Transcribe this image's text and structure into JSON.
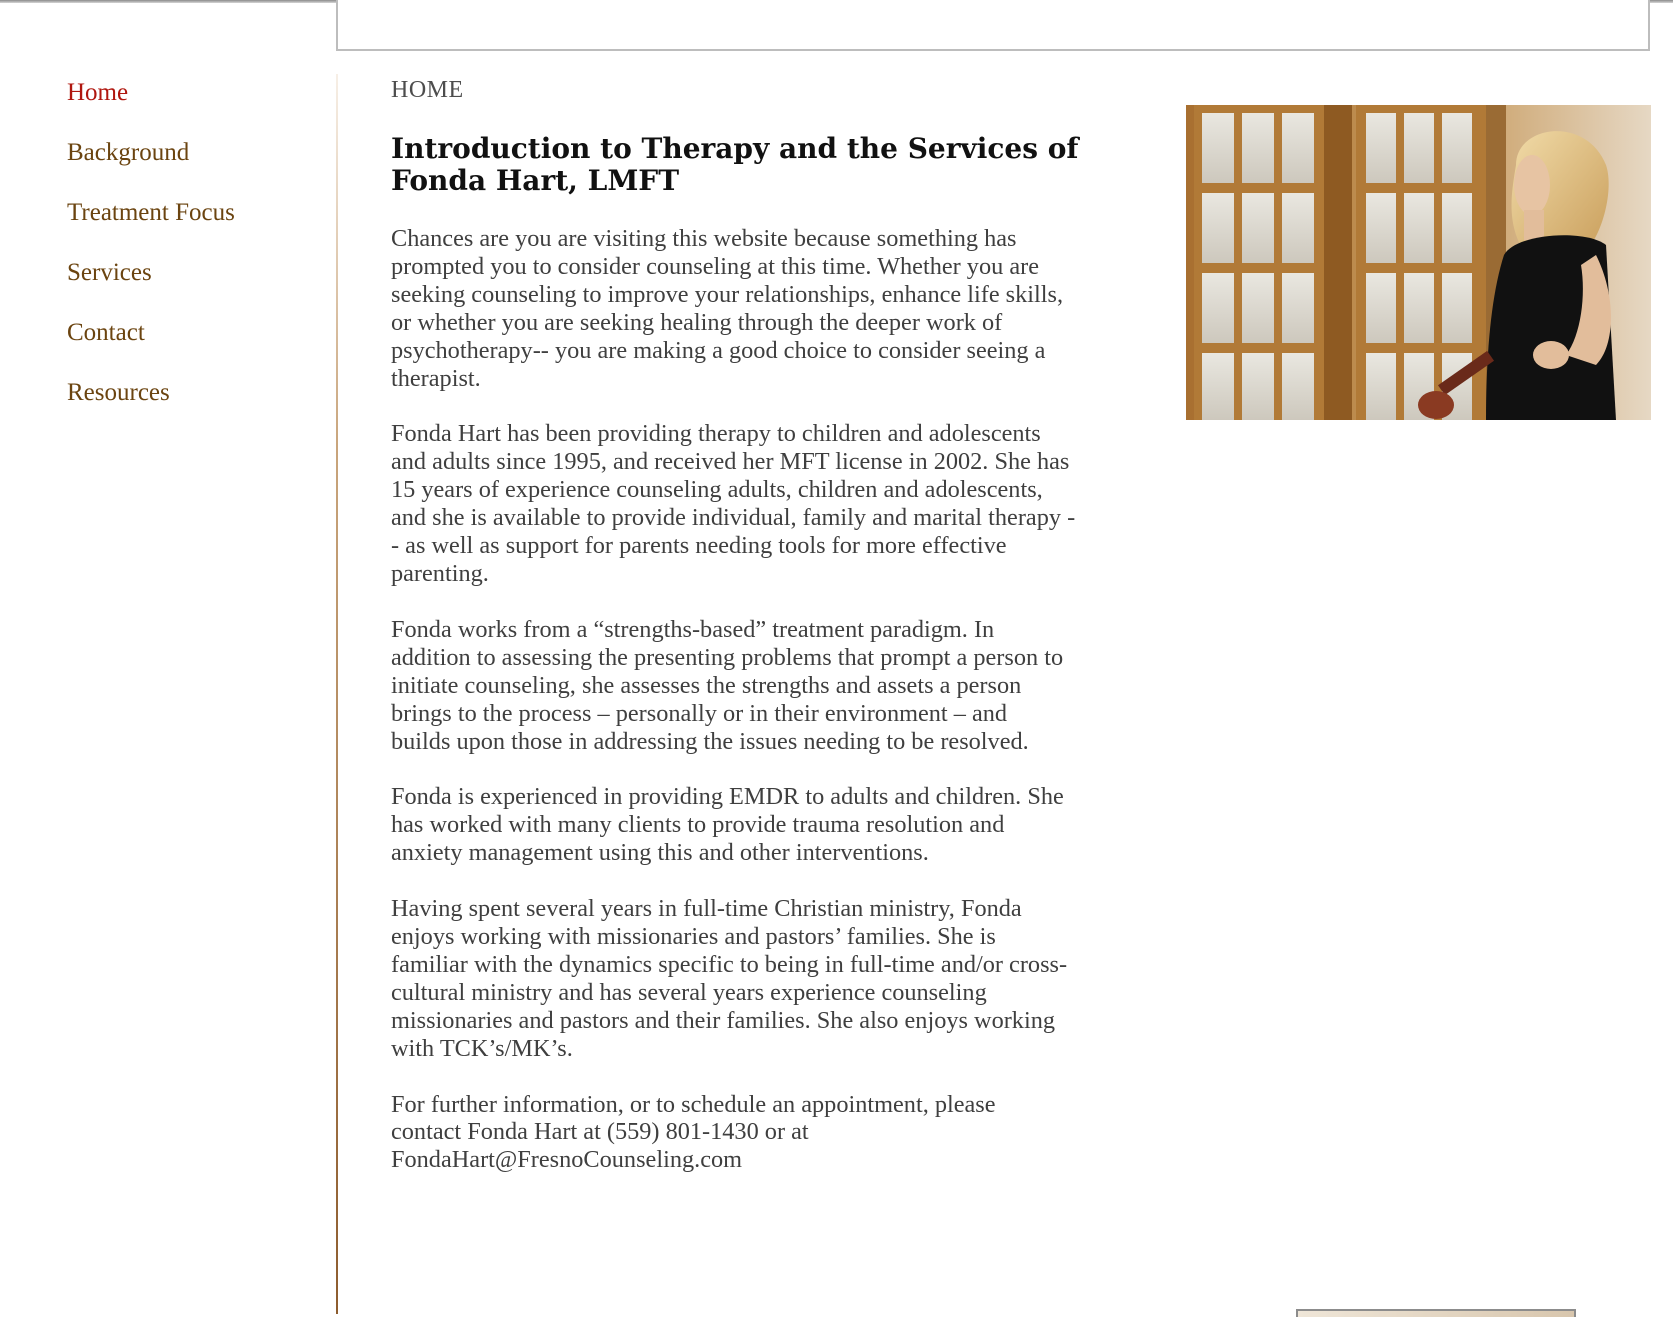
{
  "nav": {
    "items": [
      {
        "label": "Home",
        "active": true
      },
      {
        "label": "Background",
        "active": false
      },
      {
        "label": "Treatment Focus",
        "active": false
      },
      {
        "label": "Services",
        "active": false
      },
      {
        "label": "Contact",
        "active": false
      },
      {
        "label": "Resources",
        "active": false
      }
    ]
  },
  "main": {
    "breadcrumb": "HOME",
    "title": "Introduction to Therapy and the Services of Fonda Hart, LMFT",
    "paragraphs": [
      "Chances are you are visiting this website because something has\nprompted you to consider counseling at this time.  Whether you are\nseeking counseling to improve your relationships, enhance life skills,\nor whether you are seeking healing through the deeper work of\npsychotherapy-- you are making a good choice to consider seeing a\ntherapist.",
      "Fonda Hart has been providing therapy to children and adolescents\nand adults since 1995, and received her MFT license in 2002.  She has\n15 years of experience counseling adults, children and adolescents,\nand she is available to provide individual, family and marital therapy -\n- as well as support for parents needing tools for more effective\nparenting.",
      "Fonda works from a “strengths-based” treatment paradigm.  In\naddition to assessing the presenting problems that prompt a person to\ninitiate counseling, she assesses the strengths and assets a person\nbrings to the process – personally or in their environment – and\nbuilds upon those in addressing the issues needing to be resolved.",
      "Fonda is experienced in providing EMDR to adults and children.  She\nhas worked with many clients to provide trauma resolution and\nanxiety management using this and other interventions.",
      "Having spent several years in full-time Christian ministry, Fonda\nenjoys working with missionaries and pastors’ families.  She is\nfamiliar with the dynamics specific to being in full-time and/or cross-\ncultural ministry and has several years experience counseling\nmissionaries and pastors and their families.   She also enjoys working\nwith TCK’s/MK’s.",
      "For further information, or to schedule an appointment, please\ncontact Fonda Hart at (559) 801-1430 or at\nFondaHart@FresnoCounseling.com"
    ]
  },
  "colors": {
    "nav_active": "#b0170f",
    "nav_link": "#6b4410",
    "body_text": "#3f3f3f",
    "title_text": "#111111"
  }
}
